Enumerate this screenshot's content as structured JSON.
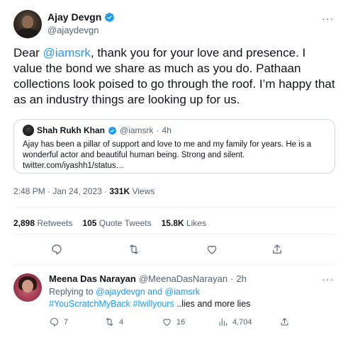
{
  "tweet": {
    "author_name": "Ajay Devgn",
    "author_handle": "@ajaydevgn",
    "more_label": "···",
    "text_prefix": "Dear ",
    "mention": "@iamsrk",
    "text_rest": ", thank you for your love and presence. I value the bond we share as much as you do. Pathaan collections look poised to go through the roof. I’m happy that as an industry things are looking up for us.",
    "quote": {
      "name": "Shah Rukh Khan",
      "handle": "@iamsrk",
      "separator": "·",
      "time": "4h",
      "text": "Ajay has been a pillar of support and love to me and my family for years. He is a wonderful actor and beautiful human being. Strong and silent.",
      "link": "twitter.com/iyashh1/status…"
    },
    "time": "2:48 PM · Jan 24, 2023 · ",
    "views_count": "331K",
    "views_label": " Views",
    "stats": {
      "retweets_count": "2,898",
      "retweets_label": " Retweets",
      "quotes_count": "105",
      "quotes_label": " Quote Tweets",
      "likes_count": "15.8K",
      "likes_label": " Likes"
    }
  },
  "reply": {
    "author_name": "Meena Das Narayan",
    "author_handle": "@MeenaDasNarayan",
    "separator": "·",
    "time": "2h",
    "more_label": "···",
    "replying_prefix": "Replying to ",
    "replying_user1": "@ajaydevgn",
    "replying_and": " and ",
    "replying_user2": "@iamsrk",
    "hashtag1": "#YouScratchMyBack",
    "hashtag2": "#Iwillyours",
    "text_rest": " ..lies and more lies",
    "replies": "7",
    "retweets": "4",
    "likes": "16",
    "views": "4,704"
  },
  "colors": {
    "accent": "#1d9bf0",
    "text": "#0f1419",
    "secondary": "#536471",
    "border": "#cfd9de"
  },
  "icons": [
    "verified-badge-icon",
    "reply-icon",
    "retweet-icon",
    "like-icon",
    "share-icon",
    "views-icon"
  ]
}
